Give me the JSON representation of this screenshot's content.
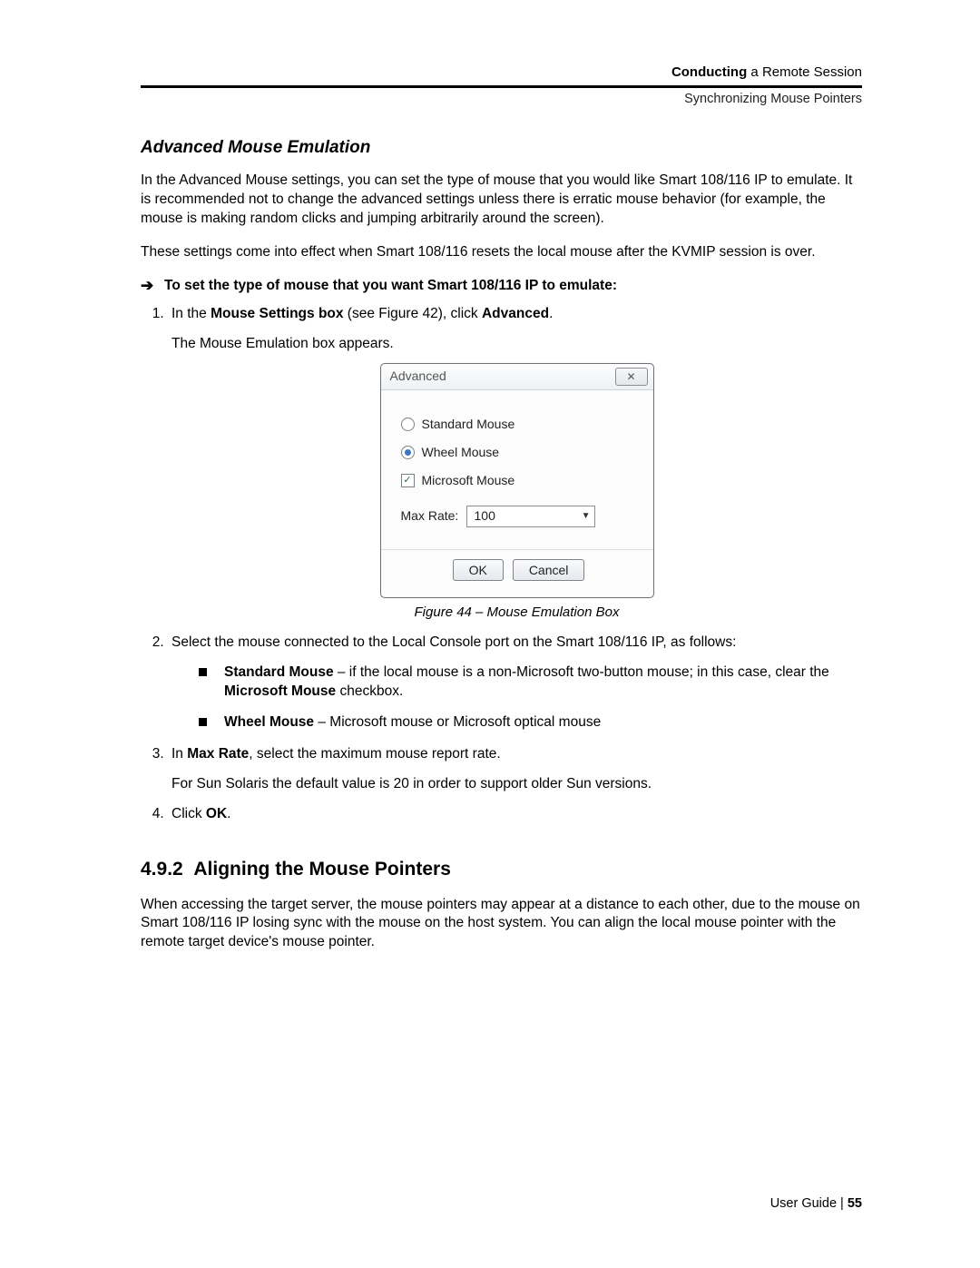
{
  "header": {
    "crumb_bold": "Conducting",
    "crumb_rest": " a Remote Session",
    "subline": "Synchronizing Mouse Pointers"
  },
  "section1": {
    "title": "Advanced Mouse Emulation",
    "para1": "In the Advanced Mouse settings, you can set the type of mouse that you would like Smart 108/116 IP to emulate. It is recommended not to change the advanced settings unless there is erratic mouse behavior (for example, the mouse is making random clicks and jumping arbitrarily around the screen).",
    "para2": "These settings come into effect when Smart 108/116 resets the local mouse after the KVMIP session is over.",
    "procedure_title": "To set the type of mouse that you want Smart 108/116 IP to emulate:"
  },
  "steps": {
    "s1_pre": "In the ",
    "s1_b1": "Mouse Settings box",
    "s1_mid": " (see Figure 42), click ",
    "s1_b2": "Advanced",
    "s1_post": ".",
    "s1_sub": "The Mouse Emulation box appears.",
    "s2": "Select the mouse connected to the Local Console port on the Smart 108/116 IP, as follows:",
    "s2_a_b": "Standard Mouse",
    "s2_a_rest": " – if the local mouse is a non-Microsoft two-button mouse; in this case, clear the ",
    "s2_a_b2": "Microsoft Mouse",
    "s2_a_rest2": " checkbox.",
    "s2_b_b": "Wheel Mouse",
    "s2_b_rest": " – Microsoft mouse or Microsoft optical mouse",
    "s3_pre": "In ",
    "s3_b": "Max Rate",
    "s3_post": ", select the maximum mouse report rate.",
    "s3_sub": "For Sun Solaris the default value is 20 in order to support older Sun versions.",
    "s4_pre": "Click ",
    "s4_b": "OK",
    "s4_post": "."
  },
  "dialog": {
    "title": "Advanced",
    "opt_standard": "Standard Mouse",
    "opt_wheel": "Wheel Mouse",
    "opt_ms": "Microsoft Mouse",
    "rate_label": "Max Rate:",
    "rate_value": "100",
    "ok": "OK",
    "cancel": "Cancel",
    "close_glyph": "✕"
  },
  "figure_caption": "Figure 44 – Mouse Emulation Box",
  "section2": {
    "number": "4.9.2",
    "title": "Aligning the Mouse Pointers",
    "para": "When accessing the target server, the mouse pointers may appear at a distance to each other, due to the mouse on Smart 108/116 IP losing sync with the mouse on the host system. You can align the local mouse pointer with the remote target device's mouse pointer."
  },
  "footer": {
    "label": "User Guide | ",
    "page": "55"
  },
  "arrow_glyph": "➔",
  "check_glyph": "✓"
}
